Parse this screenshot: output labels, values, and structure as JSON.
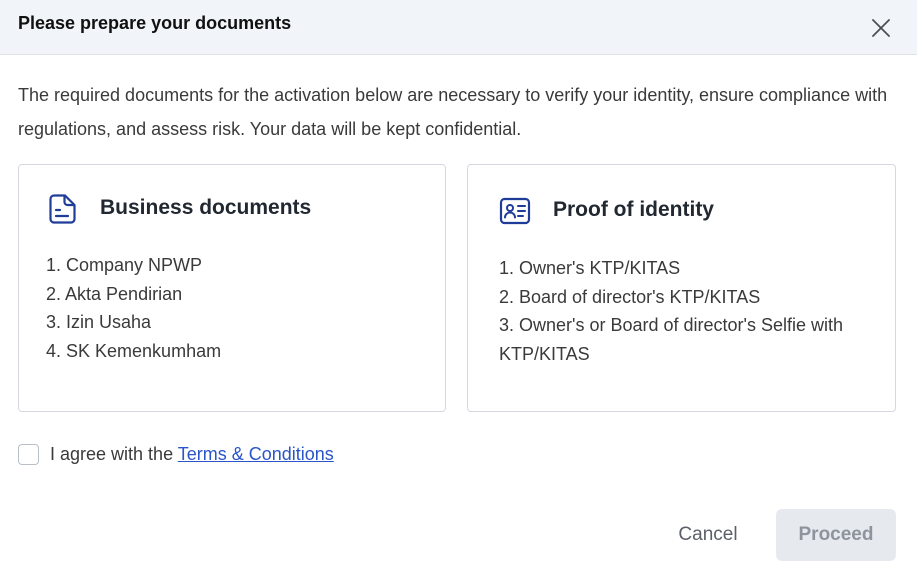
{
  "dialog": {
    "title": "Please prepare your documents",
    "intro": "The required documents for the activation below are necessary to verify your identity, ensure compliance with regulations, and assess risk. Your data will be kept confidential."
  },
  "cards": {
    "business": {
      "icon": "document-icon",
      "title": "Business documents",
      "items": [
        "1. Company NPWP",
        "2. Akta Pendirian",
        "3. Izin Usaha",
        "4. SK Kemenkumham"
      ]
    },
    "identity": {
      "icon": "id-card-icon",
      "title": "Proof of identity",
      "items": [
        "1. Owner's KTP/KITAS",
        "2. Board of director's KTP/KITAS",
        "3. Owner's or Board of director's Selfie with KTP/KITAS"
      ]
    }
  },
  "agreement": {
    "checked": false,
    "prefix": "I agree with the ",
    "link_text": "Terms & Conditions"
  },
  "footer": {
    "cancel_label": "Cancel",
    "proceed_label": "Proceed"
  },
  "colors": {
    "accent": "#1f3c99",
    "link": "#2a55c9",
    "header_bg": "#f1f4f8",
    "disabled_bg": "#e6e9ee"
  }
}
